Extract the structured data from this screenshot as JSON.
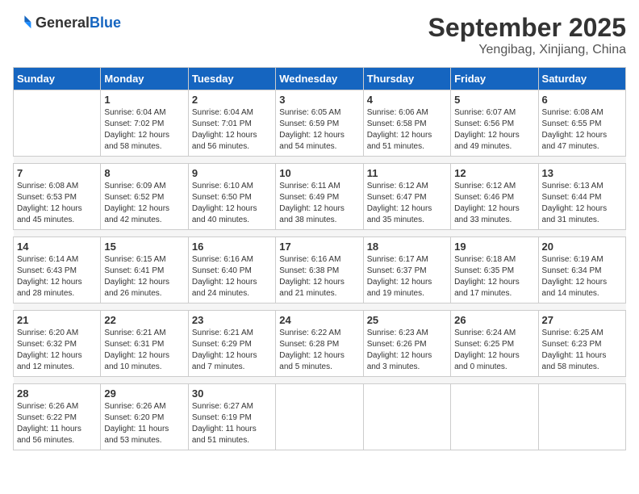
{
  "header": {
    "logo_general": "General",
    "logo_blue": "Blue",
    "month": "September 2025",
    "location": "Yengibag, Xinjiang, China"
  },
  "days_of_week": [
    "Sunday",
    "Monday",
    "Tuesday",
    "Wednesday",
    "Thursday",
    "Friday",
    "Saturday"
  ],
  "weeks": [
    {
      "days": [
        {
          "number": "",
          "info": ""
        },
        {
          "number": "1",
          "info": "Sunrise: 6:04 AM\nSunset: 7:02 PM\nDaylight: 12 hours\nand 58 minutes."
        },
        {
          "number": "2",
          "info": "Sunrise: 6:04 AM\nSunset: 7:01 PM\nDaylight: 12 hours\nand 56 minutes."
        },
        {
          "number": "3",
          "info": "Sunrise: 6:05 AM\nSunset: 6:59 PM\nDaylight: 12 hours\nand 54 minutes."
        },
        {
          "number": "4",
          "info": "Sunrise: 6:06 AM\nSunset: 6:58 PM\nDaylight: 12 hours\nand 51 minutes."
        },
        {
          "number": "5",
          "info": "Sunrise: 6:07 AM\nSunset: 6:56 PM\nDaylight: 12 hours\nand 49 minutes."
        },
        {
          "number": "6",
          "info": "Sunrise: 6:08 AM\nSunset: 6:55 PM\nDaylight: 12 hours\nand 47 minutes."
        }
      ]
    },
    {
      "days": [
        {
          "number": "7",
          "info": "Sunrise: 6:08 AM\nSunset: 6:53 PM\nDaylight: 12 hours\nand 45 minutes."
        },
        {
          "number": "8",
          "info": "Sunrise: 6:09 AM\nSunset: 6:52 PM\nDaylight: 12 hours\nand 42 minutes."
        },
        {
          "number": "9",
          "info": "Sunrise: 6:10 AM\nSunset: 6:50 PM\nDaylight: 12 hours\nand 40 minutes."
        },
        {
          "number": "10",
          "info": "Sunrise: 6:11 AM\nSunset: 6:49 PM\nDaylight: 12 hours\nand 38 minutes."
        },
        {
          "number": "11",
          "info": "Sunrise: 6:12 AM\nSunset: 6:47 PM\nDaylight: 12 hours\nand 35 minutes."
        },
        {
          "number": "12",
          "info": "Sunrise: 6:12 AM\nSunset: 6:46 PM\nDaylight: 12 hours\nand 33 minutes."
        },
        {
          "number": "13",
          "info": "Sunrise: 6:13 AM\nSunset: 6:44 PM\nDaylight: 12 hours\nand 31 minutes."
        }
      ]
    },
    {
      "days": [
        {
          "number": "14",
          "info": "Sunrise: 6:14 AM\nSunset: 6:43 PM\nDaylight: 12 hours\nand 28 minutes."
        },
        {
          "number": "15",
          "info": "Sunrise: 6:15 AM\nSunset: 6:41 PM\nDaylight: 12 hours\nand 26 minutes."
        },
        {
          "number": "16",
          "info": "Sunrise: 6:16 AM\nSunset: 6:40 PM\nDaylight: 12 hours\nand 24 minutes."
        },
        {
          "number": "17",
          "info": "Sunrise: 6:16 AM\nSunset: 6:38 PM\nDaylight: 12 hours\nand 21 minutes."
        },
        {
          "number": "18",
          "info": "Sunrise: 6:17 AM\nSunset: 6:37 PM\nDaylight: 12 hours\nand 19 minutes."
        },
        {
          "number": "19",
          "info": "Sunrise: 6:18 AM\nSunset: 6:35 PM\nDaylight: 12 hours\nand 17 minutes."
        },
        {
          "number": "20",
          "info": "Sunrise: 6:19 AM\nSunset: 6:34 PM\nDaylight: 12 hours\nand 14 minutes."
        }
      ]
    },
    {
      "days": [
        {
          "number": "21",
          "info": "Sunrise: 6:20 AM\nSunset: 6:32 PM\nDaylight: 12 hours\nand 12 minutes."
        },
        {
          "number": "22",
          "info": "Sunrise: 6:21 AM\nSunset: 6:31 PM\nDaylight: 12 hours\nand 10 minutes."
        },
        {
          "number": "23",
          "info": "Sunrise: 6:21 AM\nSunset: 6:29 PM\nDaylight: 12 hours\nand 7 minutes."
        },
        {
          "number": "24",
          "info": "Sunrise: 6:22 AM\nSunset: 6:28 PM\nDaylight: 12 hours\nand 5 minutes."
        },
        {
          "number": "25",
          "info": "Sunrise: 6:23 AM\nSunset: 6:26 PM\nDaylight: 12 hours\nand 3 minutes."
        },
        {
          "number": "26",
          "info": "Sunrise: 6:24 AM\nSunset: 6:25 PM\nDaylight: 12 hours\nand 0 minutes."
        },
        {
          "number": "27",
          "info": "Sunrise: 6:25 AM\nSunset: 6:23 PM\nDaylight: 11 hours\nand 58 minutes."
        }
      ]
    },
    {
      "days": [
        {
          "number": "28",
          "info": "Sunrise: 6:26 AM\nSunset: 6:22 PM\nDaylight: 11 hours\nand 56 minutes."
        },
        {
          "number": "29",
          "info": "Sunrise: 6:26 AM\nSunset: 6:20 PM\nDaylight: 11 hours\nand 53 minutes."
        },
        {
          "number": "30",
          "info": "Sunrise: 6:27 AM\nSunset: 6:19 PM\nDaylight: 11 hours\nand 51 minutes."
        },
        {
          "number": "",
          "info": ""
        },
        {
          "number": "",
          "info": ""
        },
        {
          "number": "",
          "info": ""
        },
        {
          "number": "",
          "info": ""
        }
      ]
    }
  ]
}
